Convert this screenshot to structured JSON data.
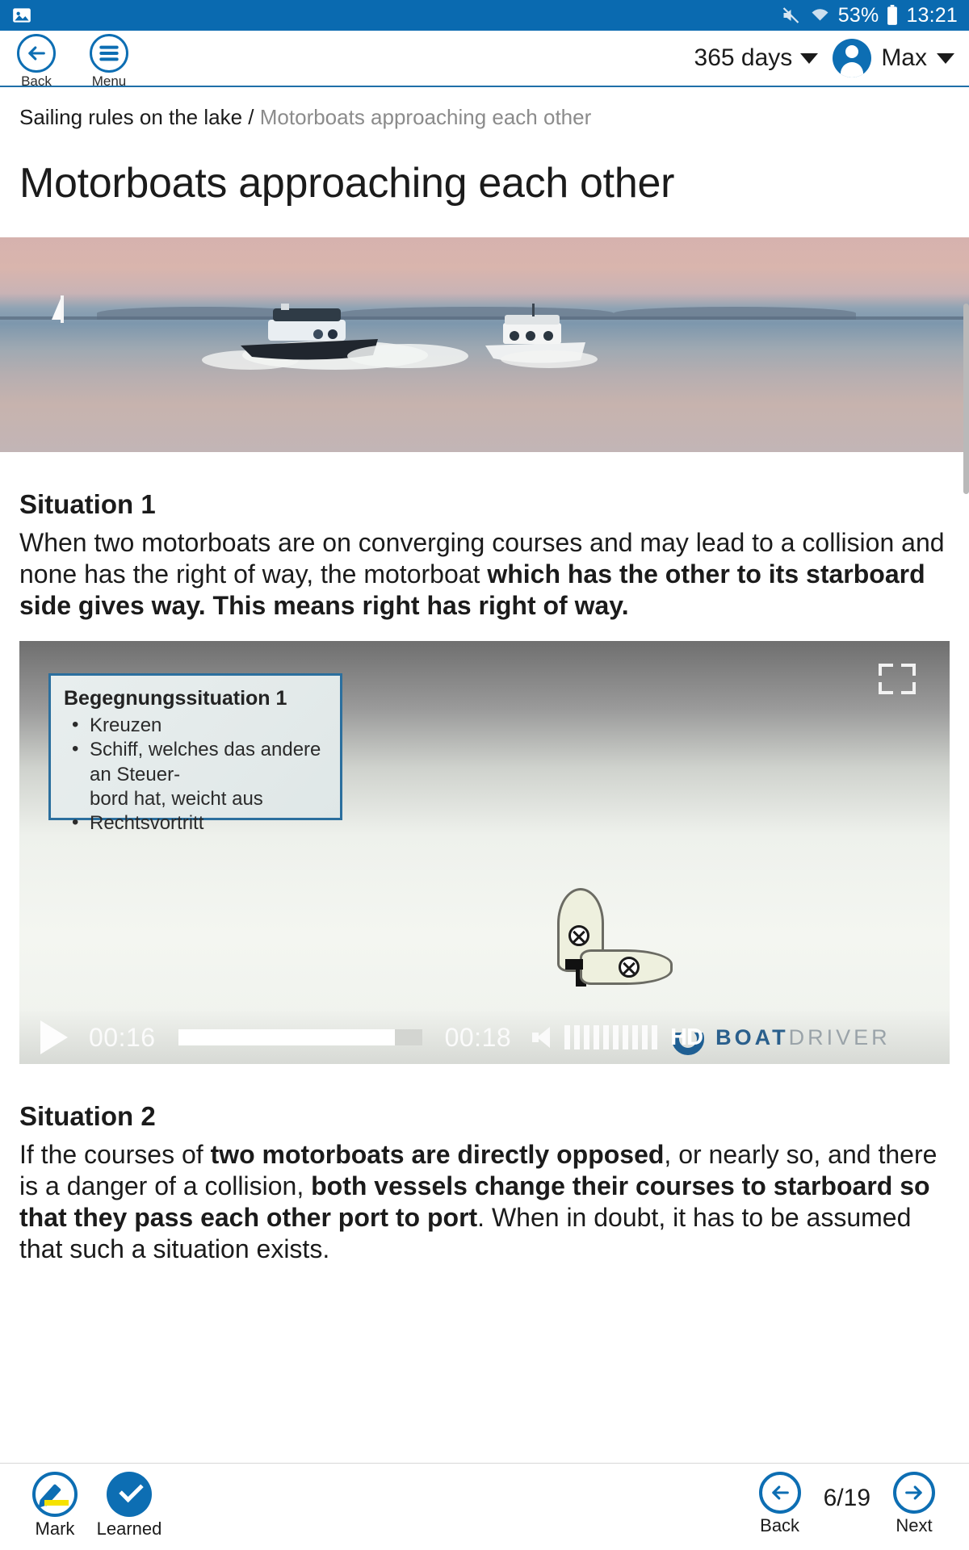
{
  "status_bar": {
    "mute_icon": "mute-icon",
    "wifi_icon": "wifi-icon",
    "battery_percent": "53%",
    "battery_icon": "battery-icon",
    "clock": "13:21",
    "notification_icon": "image-notification-icon",
    "background_color": "#0a6ab0"
  },
  "header": {
    "back_label": "Back",
    "menu_label": "Menu",
    "subscription": "365 days",
    "user_name": "Max",
    "accent_color": "#0d6eb3"
  },
  "breadcrumb": {
    "parent": "Sailing rules on the lake",
    "separator": "/",
    "current": "Motorboats approaching each other"
  },
  "page": {
    "title": "Motorboats approaching each other"
  },
  "sections": [
    {
      "heading": "Situation 1",
      "paragraph_parts": [
        {
          "text": "When two motorboats are on converging courses and may lead to a collision and none has the right of way, the motorboat ",
          "bold": false
        },
        {
          "text": "which has the other to its starboard side gives way. This means right has right of way.",
          "bold": true
        }
      ]
    },
    {
      "heading": "Situation 2",
      "paragraph_parts": [
        {
          "text": "If the courses of ",
          "bold": false
        },
        {
          "text": "two motorboats are directly opposed",
          "bold": true
        },
        {
          "text": ", or nearly so, and there is a danger of a collision, ",
          "bold": false
        },
        {
          "text": "both vessels change their courses to starboard so that they pass each other port to port",
          "bold": true
        },
        {
          "text": ". When in doubt, it has to be assumed that such a situation exists.",
          "bold": false
        }
      ]
    }
  ],
  "video": {
    "infobox": {
      "title": "Begegnungssituation 1",
      "bullets": [
        "Kreuzen",
        "Schiff, welches das andere an Steuer-",
        "bord hat, weicht aus",
        "Rechtsvortritt"
      ]
    },
    "fullscreen_icon": "fullscreen-icon",
    "play_icon": "play-icon",
    "current_time": "00:16",
    "duration": "00:18",
    "progress_percent": 89,
    "volume_icon": "speaker-icon",
    "volume_bars": 10,
    "hd_badge": "HD",
    "brand_bold": "BOAT",
    "brand_light": "DRIVER"
  },
  "bottom_bar": {
    "mark_label": "Mark",
    "mark_icon": "pencil-marker-icon",
    "learned_label": "Learned",
    "learned_icon": "check-icon",
    "back_label": "Back",
    "back_icon": "arrow-left-icon",
    "next_label": "Next",
    "next_icon": "arrow-right-icon",
    "page_indicator": "6/19"
  }
}
